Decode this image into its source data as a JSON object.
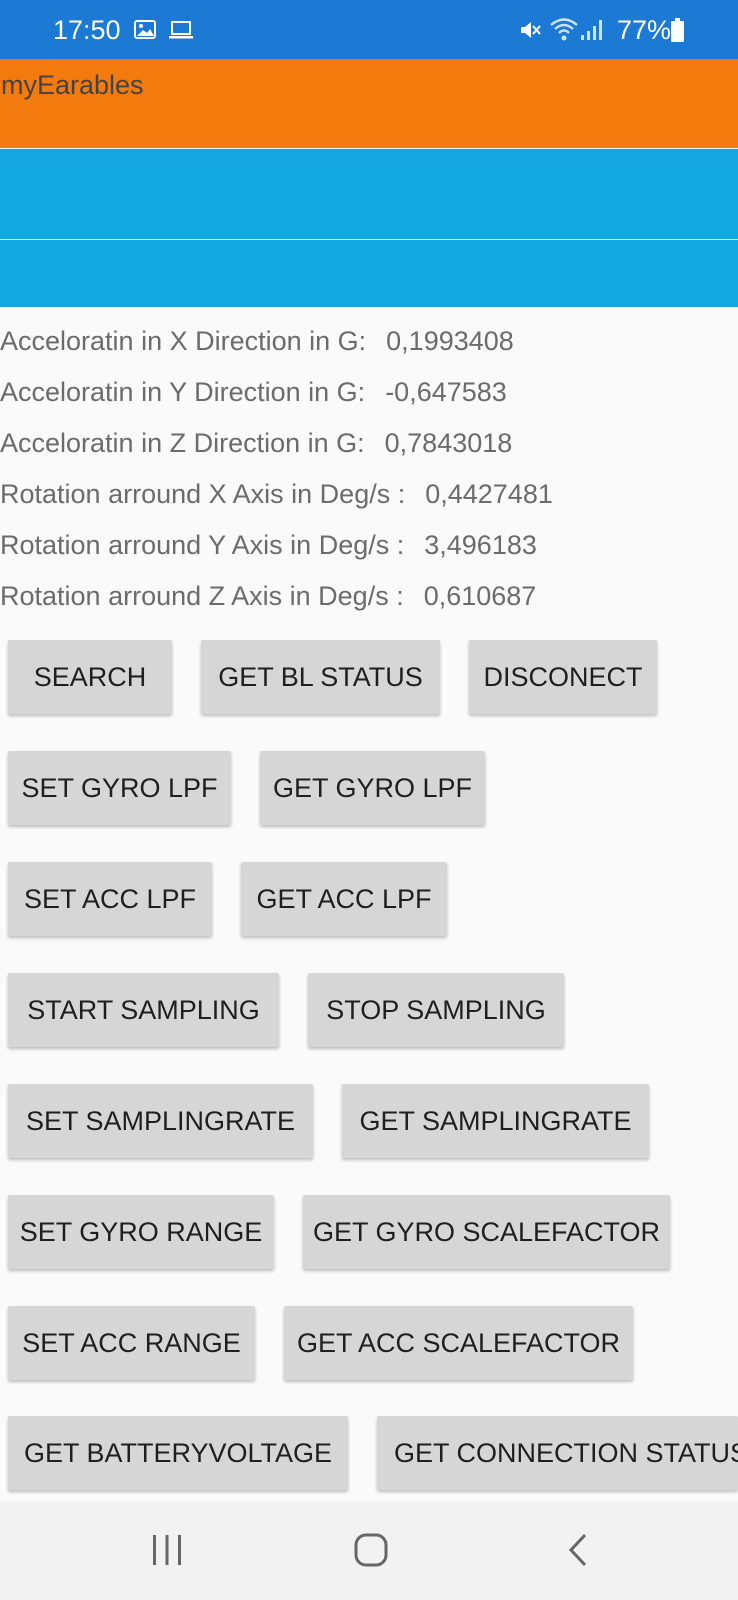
{
  "status_bar": {
    "time": "17:50",
    "battery": "77%",
    "icons": [
      "gallery-icon",
      "laptop-icon",
      "mute-icon",
      "wifi-icon",
      "signal-icon",
      "battery-icon"
    ],
    "color": "#1c79d4"
  },
  "app": {
    "title": "myEarables",
    "title_bar_color": "#f37a0c",
    "band_color": "#12a8df"
  },
  "readings": [
    {
      "label": "Acceloratin in X Direction in G:",
      "value": "0,1993408"
    },
    {
      "label": "Acceloratin in Y Direction in G:",
      "value": "-0,647583"
    },
    {
      "label": "Acceloratin in Z Direction in G:",
      "value": "0,7843018"
    },
    {
      "label": "Rotation arround X Axis in Deg/s :",
      "value": "0,4427481"
    },
    {
      "label": "Rotation arround Y Axis in Deg/s :",
      "value": "3,496183"
    },
    {
      "label": "Rotation arround Z Axis in Deg/s :",
      "value": "0,610687"
    }
  ],
  "buttons": {
    "search": "SEARCH",
    "get_bl_status": "GET BL STATUS",
    "disconnect": "DISCONECT",
    "set_gyro_lpf": "SET GYRO LPF",
    "get_gyro_lpf": "GET GYRO LPF",
    "set_acc_lpf": "SET ACC LPF",
    "get_acc_lpf": "GET ACC LPF",
    "start_sampling": "START SAMPLING",
    "stop_sampling": "STOP SAMPLING",
    "set_samplingrate": "SET SAMPLINGRATE",
    "get_samplingrate": "GET SAMPLINGRATE",
    "set_gyro_range": "SET GYRO RANGE",
    "get_gyro_scalefactor": "GET GYRO SCALEFACTOR",
    "set_acc_range": "SET ACC RANGE",
    "get_acc_scalefactor": "GET ACC SCALEFACTOR",
    "get_batteryvoltage": "GET BATTERYVOLTAGE",
    "get_connection_status": "GET CONNECTION STATUS"
  },
  "nav_bar": {
    "icons": [
      "recent-apps-icon",
      "home-icon",
      "back-icon"
    ]
  }
}
